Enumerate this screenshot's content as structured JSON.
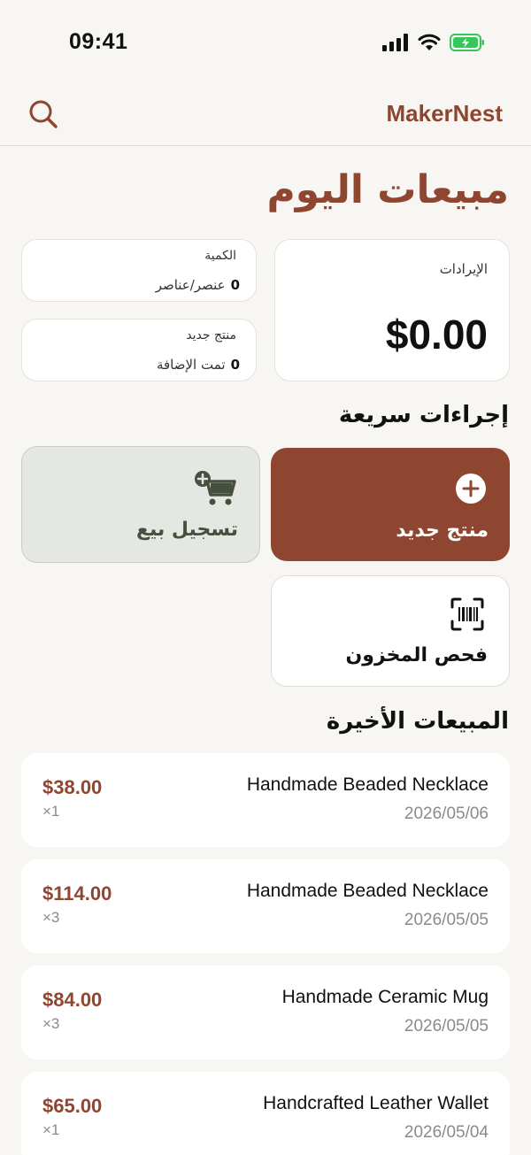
{
  "status_bar": {
    "time": "09:41"
  },
  "header": {
    "brand": "MakerNest",
    "search_icon": "search-icon"
  },
  "page_title": "مبيعات اليوم",
  "stats": {
    "revenue": {
      "label": "الإيرادات",
      "value": "$0.00"
    },
    "quantity": {
      "label": "الكمية",
      "value": "0",
      "unit": "عنصر/عناصر"
    },
    "new_product": {
      "label": "منتج جديد",
      "value": "0",
      "unit": "تمت الإضافة"
    }
  },
  "quick_actions": {
    "title": "إجراءات سريعة",
    "new_product": {
      "label": "منتج جديد",
      "icon": "plus-circle-icon"
    },
    "record_sale": {
      "label": "تسجيل بيع",
      "icon": "cart-add-icon"
    },
    "check_inventory": {
      "label": "فحص المخزون",
      "icon": "barcode-scan-icon"
    }
  },
  "recent_sales": {
    "title": "المبيعات الأخيرة",
    "items": [
      {
        "name": "Handmade Beaded Necklace",
        "date": "2026/05/06",
        "price": "$38.00",
        "qty": "×1"
      },
      {
        "name": "Handmade Beaded Necklace",
        "date": "2026/05/05",
        "price": "$114.00",
        "qty": "×3"
      },
      {
        "name": "Handmade Ceramic Mug",
        "date": "2026/05/05",
        "price": "$84.00",
        "qty": "×3"
      },
      {
        "name": "Handcrafted Leather Wallet",
        "date": "2026/05/04",
        "price": "$65.00",
        "qty": "×1"
      }
    ]
  },
  "colors": {
    "accent": "#8f4631",
    "background": "#f8f6f2",
    "secondary_action": "#e5e7e2",
    "battery": "#34c759"
  }
}
